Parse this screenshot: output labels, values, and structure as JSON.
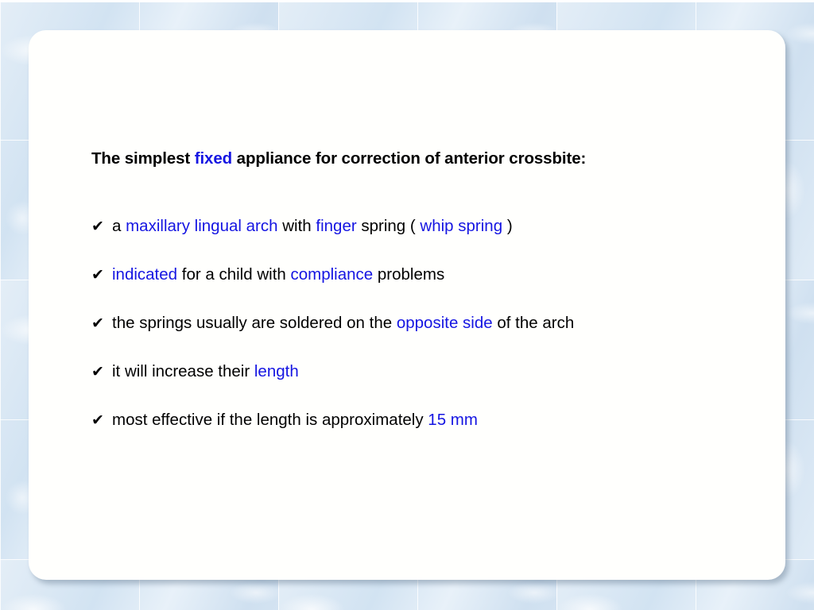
{
  "slide": {
    "title": {
      "segments": [
        {
          "text": "The simplest ",
          "style": "plain"
        },
        {
          "text": "fixed",
          "style": "highlight"
        },
        {
          "text": " appliance for correction of anterior crossbite:",
          "style": "plain"
        }
      ],
      "plain_text": "The simplest fixed appliance for correction of anterior crossbite:"
    },
    "bullet_marker": "✔",
    "bullets": [
      {
        "plain_text": "a maxillary lingual arch with finger spring ( whip spring )",
        "segments": [
          {
            "text": "a ",
            "style": "plain"
          },
          {
            "text": "maxillary lingual arch",
            "style": "highlight"
          },
          {
            "text": " with ",
            "style": "plain"
          },
          {
            "text": "finger",
            "style": "highlight"
          },
          {
            "text": " spring ( ",
            "style": "plain"
          },
          {
            "text": "whip spring",
            "style": "highlight"
          },
          {
            "text": " )",
            "style": "plain"
          }
        ]
      },
      {
        "plain_text": "indicated for a child with compliance problems",
        "segments": [
          {
            "text": "indicated",
            "style": "highlight"
          },
          {
            "text": " for a child with ",
            "style": "plain"
          },
          {
            "text": "compliance",
            "style": "highlight"
          },
          {
            "text": " problems",
            "style": "plain"
          }
        ]
      },
      {
        "plain_text": "the springs usually are soldered on the opposite side of the arch",
        "segments": [
          {
            "text": "the springs usually are soldered on the ",
            "style": "plain"
          },
          {
            "text": "opposite side",
            "style": "highlight"
          },
          {
            "text": " of the arch",
            "style": "plain"
          }
        ]
      },
      {
        "plain_text": "it will increase their length",
        "segments": [
          {
            "text": "it will increase their ",
            "style": "plain"
          },
          {
            "text": "length",
            "style": "highlight"
          }
        ]
      },
      {
        "plain_text": "most effective if the length is approximately 15 mm",
        "segments": [
          {
            "text": "most effective if the length is approximately ",
            "style": "plain"
          },
          {
            "text": "15 mm",
            "style": "highlight"
          }
        ]
      }
    ]
  },
  "colors": {
    "highlight_blue": "#1515e2",
    "body_text": "#000000",
    "slide_background": "#fffffd",
    "canvas_background": "#dce9f4"
  }
}
